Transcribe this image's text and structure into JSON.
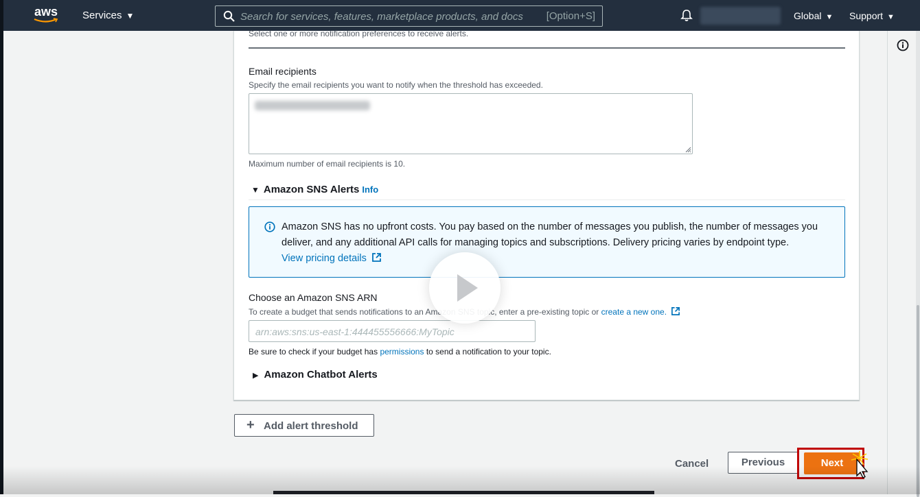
{
  "nav": {
    "logo_text": "aws",
    "services_label": "Services",
    "search_placeholder": "Search for services, features, marketplace products, and docs",
    "search_shortcut": "[Option+S]",
    "region_label": "Global",
    "support_label": "Support"
  },
  "form": {
    "notification_hint": "Select one or more notification preferences to receive alerts.",
    "email": {
      "label": "Email recipients",
      "description": "Specify the email recipients you want to notify when the threshold has exceeded.",
      "constraint": "Maximum number of email recipients is 10."
    },
    "sns": {
      "section_title": "Amazon SNS Alerts",
      "info_link": "Info",
      "alert_text": "Amazon SNS has no upfront costs. You pay based on the number of messages you publish, the number of messages you deliver, and any additional API calls for managing topics and subscriptions. Delivery pricing varies by endpoint type.",
      "pricing_link": "View pricing details",
      "arn_label": "Choose an Amazon SNS ARN",
      "arn_description_pre": "To create a budget that sends notifications to an Amazon SNS topic, enter a pre-existing topic or ",
      "arn_create_link": "create a new one.",
      "arn_placeholder": "arn:aws:sns:us-east-1:444455556666:MyTopic",
      "permissions_pre": "Be sure to check if your budget has ",
      "permissions_link": "permissions",
      "permissions_post": " to send a notification to your topic."
    },
    "chatbot": {
      "section_title": "Amazon Chatbot Alerts"
    }
  },
  "actions": {
    "add_threshold": "Add alert threshold",
    "cancel": "Cancel",
    "previous": "Previous",
    "next": "Next"
  },
  "colors": {
    "nav_bg": "#232f3e",
    "link": "#0073bb",
    "primary_button": "#ec7211",
    "highlight_frame": "#c00000"
  }
}
